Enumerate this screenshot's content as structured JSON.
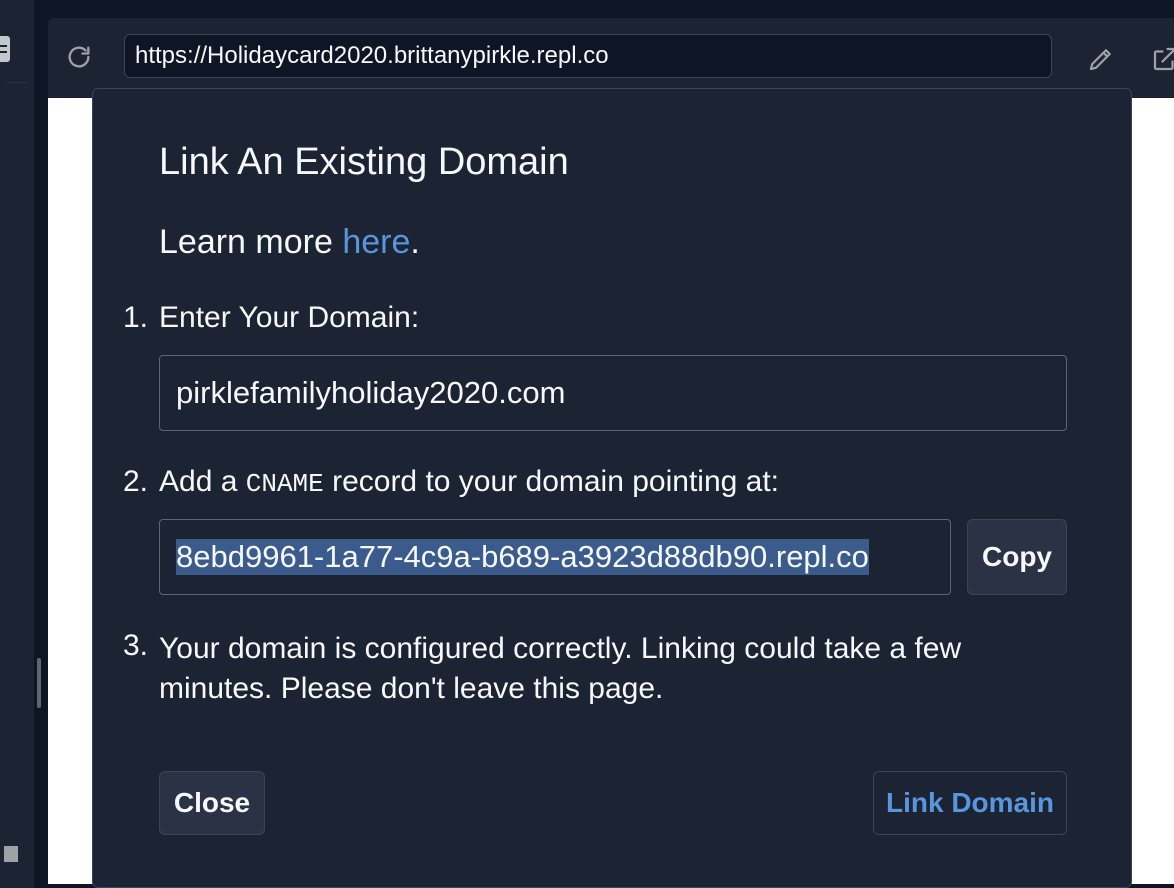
{
  "browser": {
    "url": "https://Holidaycard2020.brittanypirkle.repl.co",
    "reload_icon": "reload-icon",
    "edit_icon": "pencil-icon",
    "external_icon": "external-link-icon"
  },
  "modal": {
    "title": "Link An Existing Domain",
    "learn_more_prefix": "Learn more ",
    "learn_more_link": "here",
    "learn_more_suffix": ".",
    "step1": {
      "number": "1.",
      "label": "Enter Your Domain:",
      "input_value": "pirklefamilyholiday2020.com"
    },
    "step2": {
      "number": "2.",
      "label_prefix": "Add a ",
      "label_code": "CNAME",
      "label_suffix": " record to your domain pointing at:",
      "cname_value": "8ebd9961-1a77-4c9a-b689-a3923d88db90.repl.co",
      "copy_label": "Copy"
    },
    "step3": {
      "number": "3.",
      "text": "Your domain is configured correctly. Linking could take a few minutes. Please don't leave this page."
    },
    "close_label": "Close",
    "link_label": "Link Domain"
  },
  "colors": {
    "background": "#0e1525",
    "panel": "#1c2333",
    "text": "#f5f9fc",
    "link": "#5896de",
    "selection": "#3b5b8c"
  }
}
